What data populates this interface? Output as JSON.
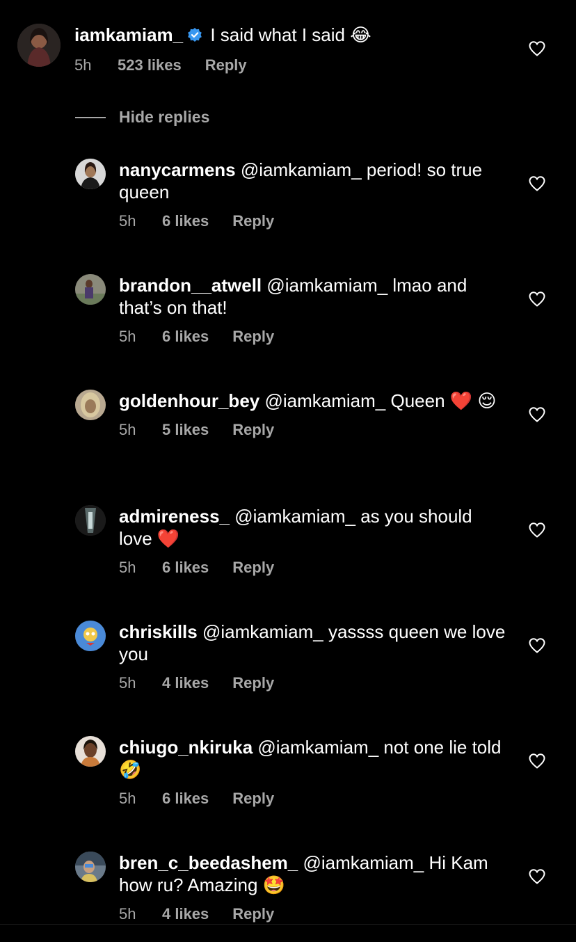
{
  "main_comment": {
    "username": "iamkamiam_",
    "verified": true,
    "text": "I said what I said 😂",
    "time": "5h",
    "likes": "523 likes",
    "reply": "Reply"
  },
  "hide_replies_label": "Hide replies",
  "replies": [
    {
      "username": "nanycarmens",
      "text": "@iamkamiam_ period! so true queen",
      "time": "5h",
      "likes": "6 likes",
      "reply": "Reply"
    },
    {
      "username": "brandon__atwell",
      "text": "@iamkamiam_ lmao and that’s on that!",
      "time": "5h",
      "likes": "6 likes",
      "reply": "Reply"
    },
    {
      "username": "goldenhour_bey",
      "text": "@iamkamiam_ Queen ❤️ 😌",
      "time": "5h",
      "likes": "5 likes",
      "reply": "Reply"
    },
    {
      "username": "admireness_",
      "text": "@iamkamiam_ as you should love ❤️",
      "time": "5h",
      "likes": "6 likes",
      "reply": "Reply"
    },
    {
      "username": "chriskills",
      "text": "@iamkamiam_ yassss queen we love you",
      "time": "5h",
      "likes": "4 likes",
      "reply": "Reply"
    },
    {
      "username": "chiugo_nkiruka",
      "text": "@iamkamiam_ not one lie told 🤣",
      "time": "5h",
      "likes": "6 likes",
      "reply": "Reply"
    },
    {
      "username": "bren_c_beedashem_",
      "text": "@iamkamiam_ Hi Kam how ru? Amazing 🤩",
      "time": "5h",
      "likes": "4 likes",
      "reply": "Reply"
    }
  ],
  "colors": {
    "background": "#000000",
    "text": "#ffffff",
    "secondary": "#a8a8a8",
    "verified": "#3897f0"
  },
  "icons": {
    "like": "heart-outline-icon",
    "verified": "verified-badge-icon"
  }
}
